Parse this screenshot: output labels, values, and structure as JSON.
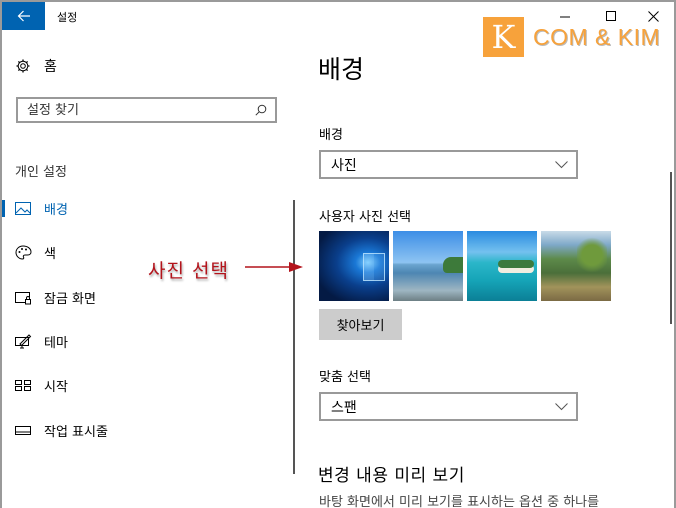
{
  "window": {
    "title": "설정",
    "back_icon": "arrow-left-icon",
    "controls": {
      "minimize": "minimize-icon",
      "maximize": "maximize-icon",
      "close": "close-icon"
    }
  },
  "logo": {
    "letter": "K",
    "text": "COM & KIM",
    "color": "#f7a23b"
  },
  "sidebar": {
    "home": {
      "label": "홈",
      "icon": "gear-icon"
    },
    "search": {
      "placeholder": "설정 찾기",
      "value": "",
      "icon": "search-icon"
    },
    "section_title": "개인 설정",
    "items": [
      {
        "label": "배경",
        "icon": "picture-icon",
        "active": true
      },
      {
        "label": "색",
        "icon": "palette-icon",
        "active": false
      },
      {
        "label": "잠금 화면",
        "icon": "lock-screen-icon",
        "active": false
      },
      {
        "label": "테마",
        "icon": "theme-brush-icon",
        "active": false
      },
      {
        "label": "시작",
        "icon": "start-tiles-icon",
        "active": false
      },
      {
        "label": "작업 표시줄",
        "icon": "taskbar-icon",
        "active": false
      }
    ],
    "accent_color": "#0063b1"
  },
  "annotation": {
    "text": "사진 선택",
    "color": "#b3131b"
  },
  "main": {
    "page_title": "배경",
    "background": {
      "label": "배경",
      "selected": "사진"
    },
    "photo_picker": {
      "label": "사용자 사진 선택",
      "thumbnails": [
        "windows-10-hero-wallpaper",
        "calm-lake-wallpaper",
        "tropical-island-wallpaper",
        "lakeside-forest-wallpaper"
      ],
      "browse_label": "찾아보기"
    },
    "fit": {
      "label": "맞춤 선택",
      "selected": "스팬"
    },
    "preview": {
      "title": "변경 내용 미리 보기",
      "description": "바탕 화면에서 미리 보기를 표시하는 옵션 중 하나를"
    }
  }
}
